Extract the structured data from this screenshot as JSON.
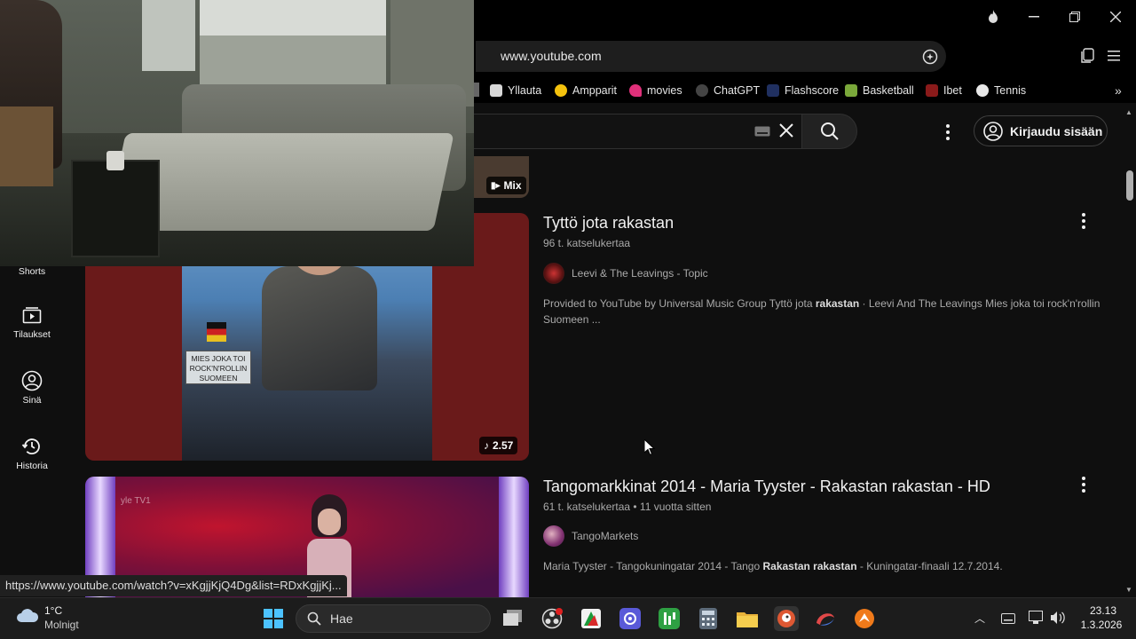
{
  "browser": {
    "url": "www.youtube.com",
    "bookmarks": [
      {
        "label": "Yllauta",
        "color": "#d8d8d8"
      },
      {
        "label": "Ampparit",
        "color": "#f4c20d"
      },
      {
        "label": "movies",
        "color": "#e0307a"
      },
      {
        "label": "ChatGPT",
        "color": "#444444"
      },
      {
        "label": "Flashscore",
        "color": "#203060"
      },
      {
        "label": "Basketball",
        "color": "#7aa83a"
      },
      {
        "label": "Ibet",
        "color": "#8a1a1a"
      },
      {
        "label": "Tennis",
        "color": "#e8e8e8"
      }
    ]
  },
  "youtube": {
    "signin_label": "Kirjaudu sisään",
    "sidebar": [
      {
        "label": "Shorts",
        "icon": "shorts-icon"
      },
      {
        "label": "Tilaukset",
        "icon": "subscriptions-icon"
      },
      {
        "label": "Sinä",
        "icon": "user-icon"
      },
      {
        "label": "Historia",
        "icon": "history-icon"
      }
    ],
    "mix_badge": "Mix",
    "videos": [
      {
        "title": "Tyttö jota rakastan",
        "meta": "96 t. katselukertaa",
        "channel": "Leevi & The Leavings - Topic",
        "desc_pre": "Provided to YouTube by Universal Music Group Tyttö jota ",
        "desc_bold": "rakastan",
        "desc_post": " · Leevi And The Leavings Mies joka toi rock'n'rollin Suomeen ...",
        "duration": "2.57",
        "album_text": "MIES JOKA TOI ROCK'N'ROLLIN SUOMEEN"
      },
      {
        "title": "Tangomarkkinat 2014 - Maria Tyyster - Rakastan rakastan - HD",
        "meta": "61 t. katselukertaa • 11 vuotta sitten",
        "channel": "TangoMarkets",
        "desc_pre": "Maria Tyyster - Tangokuningatar 2014 - Tango ",
        "desc_bold": "Rakastan rakastan",
        "desc_post": " - Kuningatar-finaali 12.7.2014.",
        "watermark": "yle TV1"
      }
    ]
  },
  "status_url": "https://www.youtube.com/watch?v=xKgjjKjQ4Dg&list=RDxKgjjKj...",
  "taskbar": {
    "weather_temp": "1°C",
    "weather_desc": "Molnigt",
    "search_placeholder": "Hae",
    "time": "23.13",
    "date": "1.3.2026"
  }
}
